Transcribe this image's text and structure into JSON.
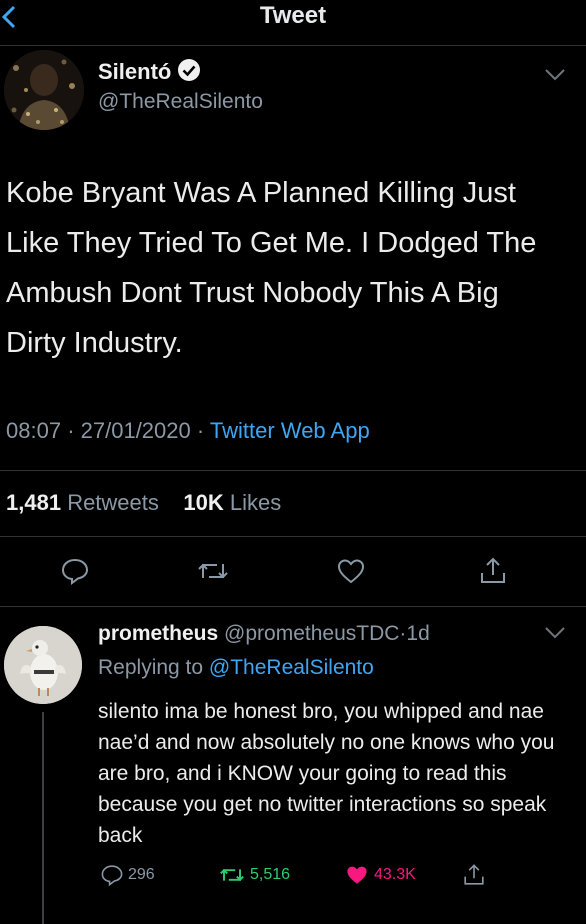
{
  "header": {
    "title": "Tweet",
    "back_icon": "chevron-left-icon"
  },
  "author": {
    "name": "Silentó",
    "handle": "@TheRealSilento",
    "verified": true
  },
  "tweet": {
    "text": "Kobe Bryant Was A Planned Killing Just Like They Tried To Get Me. I Dodged The Ambush Dont Trust Nobody This A Big Dirty Industry.",
    "time": "08:07",
    "date": "27/01/2020",
    "source": "Twitter Web App",
    "separator": "·"
  },
  "stats": {
    "retweets_count": "1,481",
    "retweets_label": "Retweets",
    "likes_count": "10K",
    "likes_label": "Likes"
  },
  "actions": [
    "reply-icon",
    "retweet-icon",
    "like-icon",
    "share-icon"
  ],
  "reply": {
    "name": "prometheus",
    "handle": "@prometheusTDC",
    "age": "1d",
    "replying_prefix": "Replying to",
    "replying_to": "@TheRealSilento",
    "text": "silento ima be honest bro, you whipped and nae nae’d and now absolutely no one knows who you are bro, and i KNOW your going to read this because you get no twitter interactions so speak back",
    "reply_count": "296",
    "retweet_count": "5,516",
    "like_count": "43.3K"
  },
  "colors": {
    "background": "#000000",
    "accent_blue": "#3ea6f2",
    "retweet_green": "#2ecc71",
    "like_red": "#f91880",
    "muted": "#8b98a5"
  }
}
